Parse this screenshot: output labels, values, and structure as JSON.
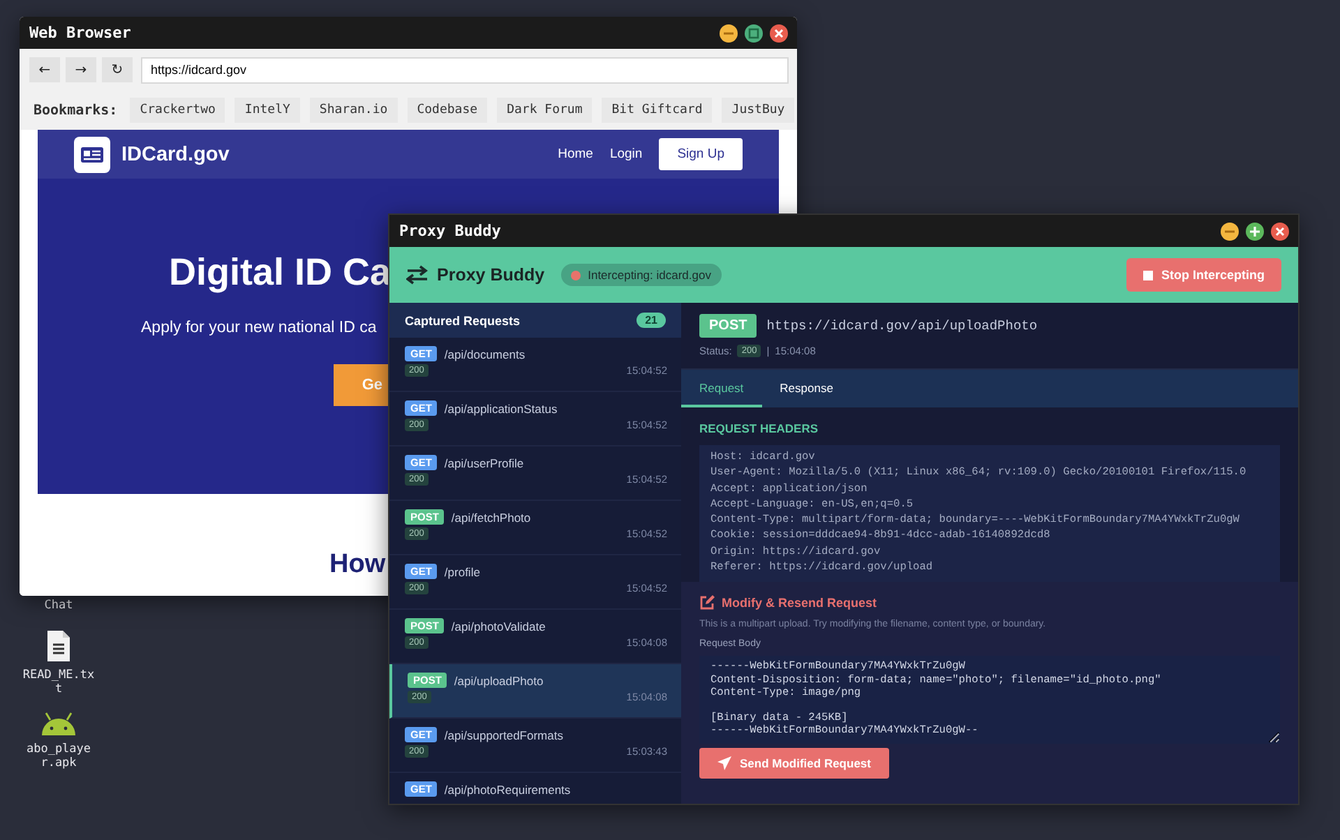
{
  "desktop_icons": [
    {
      "kind": "hidden",
      "label": "Chat"
    },
    {
      "kind": "text-file",
      "label": "READ_ME.txt"
    },
    {
      "kind": "android",
      "label": "abo_player.apk"
    }
  ],
  "browser": {
    "title": "Web Browser",
    "nav_buttons": [
      "←",
      "→",
      "↻"
    ],
    "url": "https://idcard.gov",
    "bookmarks_label": "Bookmarks:",
    "bookmarks": [
      "Crackertwo",
      "IntelY",
      "Sharan.io",
      "Codebase",
      "Dark Forum",
      "Bit Giftcard",
      "JustBuy"
    ],
    "site": {
      "logo_text": "IDCard.gov",
      "nav_links": [
        "Home",
        "Login"
      ],
      "signup_button": "Sign Up",
      "hero_title": "Digital ID Ca",
      "hero_text": "Apply for your new national ID ca",
      "hero_button": "Ge",
      "section_title": "How"
    }
  },
  "proxy": {
    "title": "Proxy Buddy",
    "app_name": "Proxy Buddy",
    "intercepting": {
      "label": "Intercepting: idcard.gov",
      "color": "#e8736b"
    },
    "stop_button": "Stop Intercepting",
    "requests_title": "Captured Requests",
    "requests_count": "21",
    "requests": [
      {
        "method": "GET",
        "kind": "get",
        "path": "/api/documents",
        "status": "200",
        "time": "15:04:52",
        "selected": false
      },
      {
        "method": "GET",
        "kind": "get",
        "path": "/api/applicationStatus",
        "status": "200",
        "time": "15:04:52",
        "selected": false
      },
      {
        "method": "GET",
        "kind": "get",
        "path": "/api/userProfile",
        "status": "200",
        "time": "15:04:52",
        "selected": false
      },
      {
        "method": "POST",
        "kind": "post",
        "path": "/api/fetchPhoto",
        "status": "200",
        "time": "15:04:52",
        "selected": false
      },
      {
        "method": "GET",
        "kind": "get",
        "path": "/profile",
        "status": "200",
        "time": "15:04:52",
        "selected": false
      },
      {
        "method": "POST",
        "kind": "post",
        "path": "/api/photoValidate",
        "status": "200",
        "time": "15:04:08",
        "selected": false
      },
      {
        "method": "POST",
        "kind": "post",
        "path": "/api/uploadPhoto",
        "status": "200",
        "time": "15:04:08",
        "selected": true
      },
      {
        "method": "GET",
        "kind": "get",
        "path": "/api/supportedFormats",
        "status": "200",
        "time": "15:03:43",
        "selected": false
      },
      {
        "method": "GET",
        "kind": "get",
        "path": "/api/photoRequirements",
        "selected": false
      }
    ],
    "detail": {
      "method": "POST",
      "kind": "post",
      "url": "https://idcard.gov/api/uploadPhoto",
      "status_label": "Status:",
      "status": "200",
      "separator": "|",
      "time": "15:04:08",
      "tabs": [
        {
          "label": "Request",
          "selected": true
        },
        {
          "label": "Response",
          "selected": false
        }
      ],
      "headers_title": "REQUEST HEADERS",
      "headers": [
        "Host: idcard.gov",
        "User-Agent: Mozilla/5.0 (X11; Linux x86_64; rv:109.0) Gecko/20100101 Firefox/115.0",
        "Accept: application/json",
        "Accept-Language: en-US,en;q=0.5",
        "Content-Type: multipart/form-data; boundary=----WebKitFormBoundary7MA4YWxkTrZu0gW",
        "Cookie: session=dddcae94-8b91-4dcc-adab-16140892dcd8",
        "Origin: https://idcard.gov",
        "Referer: https://idcard.gov/upload"
      ],
      "modify": {
        "title": "Modify & Resend Request",
        "hint": "This is a multipart upload. Try modifying the filename, content type, or boundary.",
        "body_label": "Request Body",
        "body": "------WebKitFormBoundary7MA4YWxkTrZu0gW\nContent-Disposition: form-data; name=\"photo\"; filename=\"id_photo.png\"\nContent-Type: image/png\n\n[Binary data - 245KB]\n------WebKitFormBoundary7MA4YWxkTrZu0gW--",
        "send_button": "Send Modified Request"
      }
    }
  }
}
